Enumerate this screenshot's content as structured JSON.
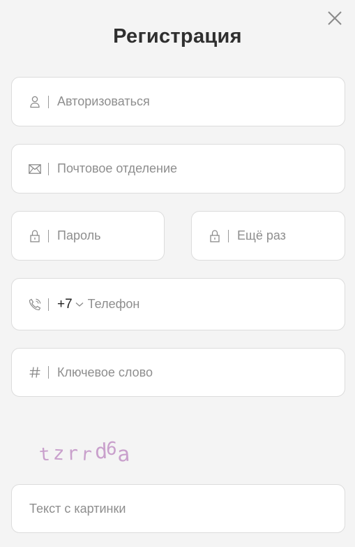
{
  "title": "Регистрация",
  "fields": {
    "login": {
      "placeholder": "Авторизоваться",
      "icon": "user-icon"
    },
    "email": {
      "placeholder": "Почтовое отделение",
      "icon": "envelope-icon"
    },
    "password": {
      "placeholder": "Пароль",
      "icon": "lock-icon"
    },
    "password_repeat": {
      "placeholder": "Ещё раз",
      "icon": "lock-icon"
    },
    "phone": {
      "code": "+7",
      "placeholder": "Телефон",
      "icon": "phone-icon"
    },
    "keyword": {
      "placeholder": "Ключевое слово",
      "icon": "hash-icon"
    }
  },
  "captcha": {
    "image_text": "tzrrd6a",
    "chars": [
      "t",
      "z",
      "r",
      "r",
      "d",
      "6",
      "a"
    ],
    "input_placeholder": "Текст с картинки"
  },
  "colors": {
    "background": "#f4f4f4",
    "field_border": "#dcdcdc",
    "captcha": "#c9a0cc"
  }
}
